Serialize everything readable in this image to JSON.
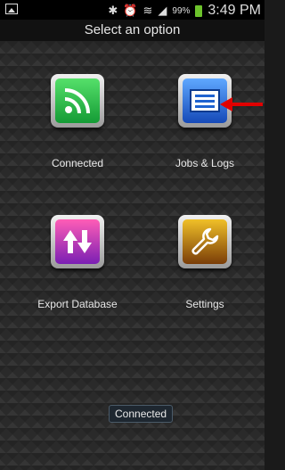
{
  "status_bar": {
    "battery_percent": "99%",
    "time": "3:49 PM",
    "battery_color": "#6cc22b"
  },
  "header": {
    "title": "Select an option"
  },
  "menu": [
    {
      "label": "Connected",
      "icon": "rss-feed-icon",
      "color": "#27b34a"
    },
    {
      "label": "Jobs & Logs",
      "icon": "list-document-icon",
      "color": "#1f63d0"
    },
    {
      "label": "Export Database",
      "icon": "up-down-arrows-icon",
      "color": "#c3186f"
    },
    {
      "label": "Settings",
      "icon": "wrench-icon",
      "color": "#b8860b"
    }
  ],
  "toast": {
    "message": "Connected"
  },
  "annotation": {
    "arrow_color": "#e00000"
  }
}
